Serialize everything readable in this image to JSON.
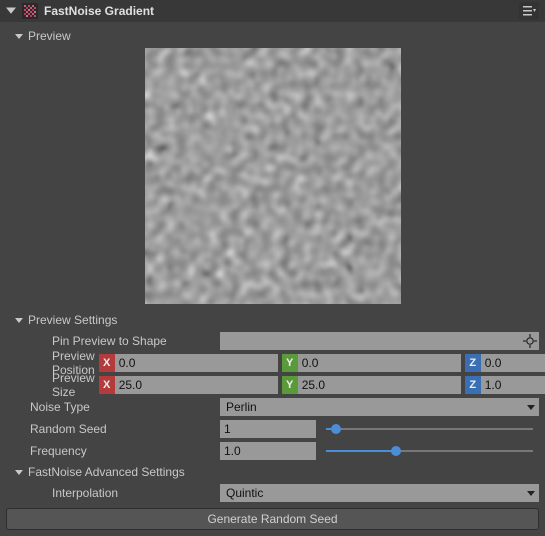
{
  "header": {
    "title": "FastNoise Gradient"
  },
  "sections": {
    "preview": "Preview",
    "preview_settings": "Preview Settings",
    "advanced": "FastNoise Advanced Settings"
  },
  "labels": {
    "pin_preview": "Pin Preview to Shape",
    "preview_position": "Preview Position",
    "preview_size": "Preview Size",
    "noise_type": "Noise Type",
    "random_seed": "Random Seed",
    "frequency": "Frequency",
    "interpolation": "Interpolation"
  },
  "axis": {
    "x": "X",
    "y": "Y",
    "z": "Z"
  },
  "values": {
    "pin_preview": "",
    "position": {
      "x": "0.0",
      "y": "0.0",
      "z": "0.0"
    },
    "size": {
      "x": "25.0",
      "y": "25.0",
      "z": "1.0"
    },
    "noise_type": "Perlin",
    "random_seed": "1",
    "random_seed_slider_pct": 5,
    "frequency": "1.0",
    "frequency_slider_pct": 34,
    "interpolation": "Quintic"
  },
  "buttons": {
    "generate": "Generate Random Seed"
  }
}
